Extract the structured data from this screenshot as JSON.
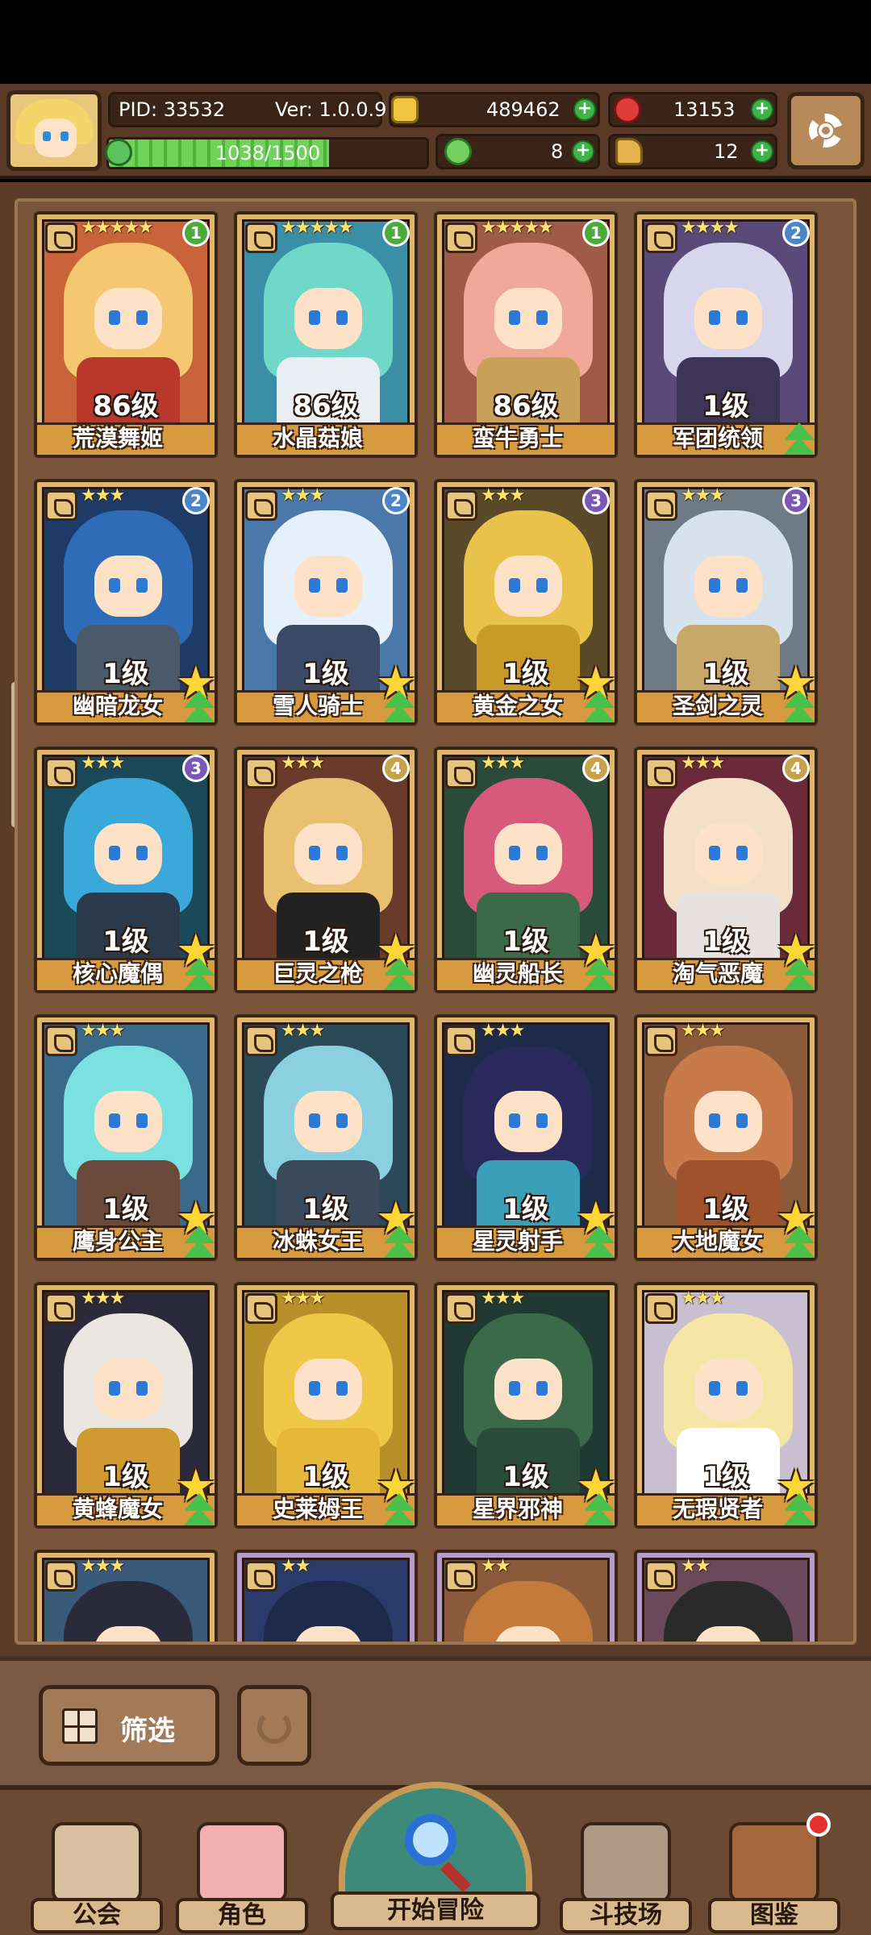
{
  "header": {
    "pid": "PID: 33532",
    "version": "Ver: 1.0.0.9",
    "gold": "489462",
    "gems": "13153",
    "exp": "1038/1500",
    "exp_fraction": 0.692,
    "clover": "8",
    "hammer": "12"
  },
  "heroes": [
    {
      "name": "荒漠舞姬",
      "level": "86级",
      "stars": "★★★★★",
      "badge": "1"
    },
    {
      "name": "水晶菇娘",
      "level": "86级",
      "stars": "★★★★★",
      "badge": "1"
    },
    {
      "name": "蛮牛勇士",
      "level": "86级",
      "stars": "★★★★★",
      "badge": "1"
    },
    {
      "name": "军团统领",
      "level": "1级",
      "stars": "★★★★",
      "badge": "2"
    },
    {
      "name": "幽暗龙女",
      "level": "1级",
      "stars": "★★★",
      "badge": "2"
    },
    {
      "name": "雪人骑士",
      "level": "1级",
      "stars": "★★★",
      "badge": "2"
    },
    {
      "name": "黄金之女",
      "level": "1级",
      "stars": "★★★",
      "badge": "3"
    },
    {
      "name": "圣剑之灵",
      "level": "1级",
      "stars": "★★★",
      "badge": "3"
    },
    {
      "name": "核心魔偶",
      "level": "1级",
      "stars": "★★★",
      "badge": "3"
    },
    {
      "name": "巨灵之枪",
      "level": "1级",
      "stars": "★★★",
      "badge": "4"
    },
    {
      "name": "幽灵船长",
      "level": "1级",
      "stars": "★★★",
      "badge": "4"
    },
    {
      "name": "淘气恶魔",
      "level": "1级",
      "stars": "★★★",
      "badge": "4"
    },
    {
      "name": "鹰身公主",
      "level": "1级",
      "stars": "★★★",
      "badge": ""
    },
    {
      "name": "冰蛛女王",
      "level": "1级",
      "stars": "★★★",
      "badge": ""
    },
    {
      "name": "星灵射手",
      "level": "1级",
      "stars": "★★★",
      "badge": ""
    },
    {
      "name": "大地魔女",
      "level": "1级",
      "stars": "★★★",
      "badge": ""
    },
    {
      "name": "黄蜂魔女",
      "level": "1级",
      "stars": "★★★",
      "badge": ""
    },
    {
      "name": "史莱姆王",
      "level": "1级",
      "stars": "★★★",
      "badge": ""
    },
    {
      "name": "星界邪神",
      "level": "1级",
      "stars": "★★★",
      "badge": ""
    },
    {
      "name": "无瑕贤者",
      "level": "1级",
      "stars": "★★★",
      "badge": ""
    },
    {
      "name": "",
      "level": "",
      "stars": "★★★",
      "badge": ""
    },
    {
      "name": "",
      "level": "",
      "stars": "★★",
      "badge": ""
    },
    {
      "name": "",
      "level": "",
      "stars": "★★",
      "badge": ""
    },
    {
      "name": "",
      "level": "",
      "stars": "★★",
      "badge": ""
    }
  ],
  "controls": {
    "filter_label": "筛选"
  },
  "nav": {
    "guild": "公会",
    "character": "角色",
    "adventure": "开始冒险",
    "arena": "斗技场",
    "codex": "图鉴"
  }
}
